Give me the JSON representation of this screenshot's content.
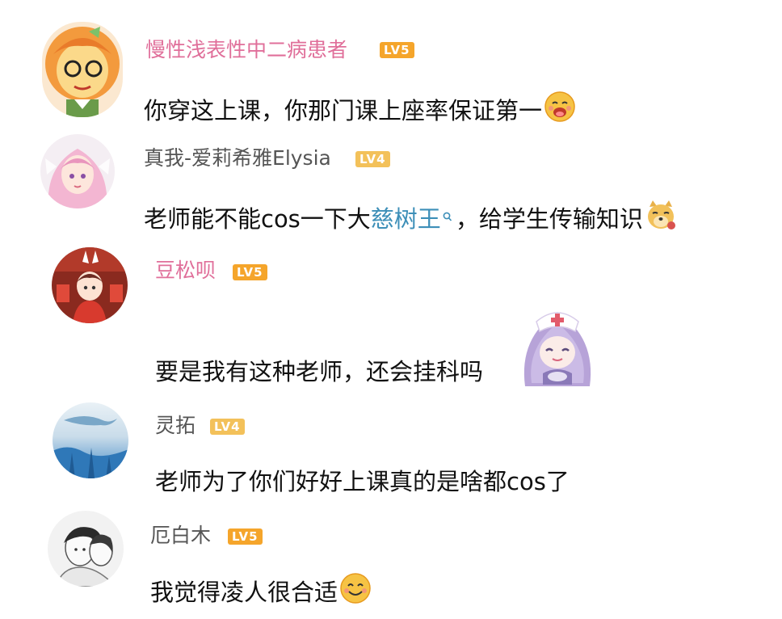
{
  "comments": [
    {
      "username": "慢性浅表性中二病患者",
      "level": "LV5",
      "text": "你穿这上课，你那门课上座率保证第一",
      "emoji": "drooling-smile-emoji",
      "avatar": "orange-hair-anime-avatar",
      "username_color": "#e06f9a"
    },
    {
      "username": "真我-爱莉希雅Elysia",
      "level": "LV4",
      "text_before": "老师能不能cos一下大",
      "link": "慈树王",
      "text_after": "，给学生传输知识",
      "emoji": "doge-emoji",
      "avatar": "pink-hair-anime-avatar",
      "username_color": "#555555"
    },
    {
      "username": "豆松呗",
      "level": "LV5",
      "text": "要是我有这种老师，还会挂科吗",
      "emoji": "purple-hair-nurse-sticker",
      "avatar": "red-costume-anime-avatar",
      "username_color": "#e06f9a"
    },
    {
      "username": "灵拓",
      "level": "LV4",
      "text": "老师为了你们好好上课真的是啥都cos了",
      "avatar": "whale-sky-avatar",
      "username_color": "#555555"
    },
    {
      "username": "厄白木",
      "level": "LV5",
      "text": "我觉得凌人很合适",
      "emoji": "smile-emoji",
      "avatar": "sketch-boy-avatar",
      "username_color": "#555555"
    }
  ]
}
